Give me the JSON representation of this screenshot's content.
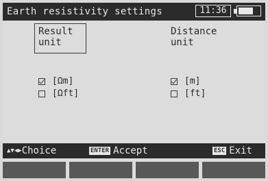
{
  "header": {
    "title": "Earth resistivity settings",
    "time": "11:36",
    "battery_level": 0.7
  },
  "result_unit": {
    "label_line1": "Result",
    "label_line2": "unit",
    "options": [
      {
        "label": "[Ωm]",
        "checked": true
      },
      {
        "label": "[Ωft]",
        "checked": false
      }
    ]
  },
  "distance_unit": {
    "label_line1": "Distance",
    "label_line2": "unit",
    "options": [
      {
        "label": "[m]",
        "checked": true
      },
      {
        "label": "[ft]",
        "checked": false
      }
    ]
  },
  "footer": {
    "choice_arrows": "▲▼◀▶",
    "choice_label": "Choice",
    "accept_key": "ENTER",
    "accept_label": "Accept",
    "exit_key": "ESC",
    "exit_label": "Exit"
  }
}
